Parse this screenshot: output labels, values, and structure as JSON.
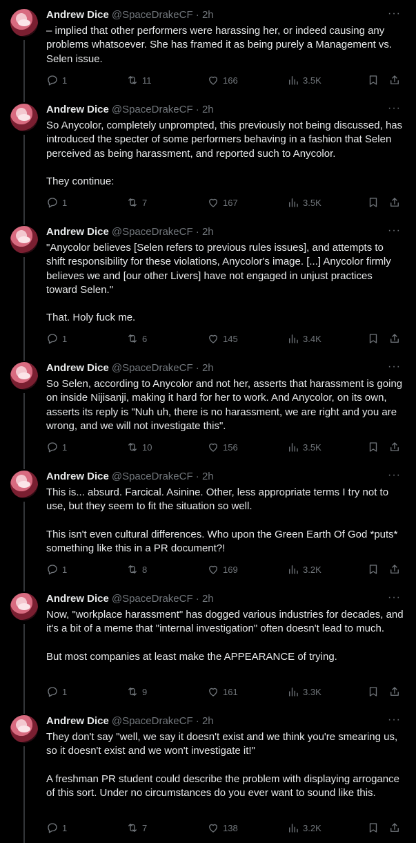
{
  "tweets": [
    {
      "name": "Andrew Dice",
      "handle": "@SpaceDrakeCF · 2h",
      "paragraphs": [
        "– implied that other performers were harassing her, or indeed causing any problems whatsoever. She has framed it as being purely a Management vs. Selen issue."
      ],
      "replies": "1",
      "retweets": "11",
      "likes": "166",
      "views": "3.5K"
    },
    {
      "name": "Andrew Dice",
      "handle": "@SpaceDrakeCF · 2h",
      "paragraphs": [
        "So Anycolor, completely unprompted, this previously not being discussed, has introduced the specter of some performers behaving in a fashion that Selen perceived as being harassment, and reported such to Anycolor.",
        "They continue:"
      ],
      "replies": "1",
      "retweets": "7",
      "likes": "167",
      "views": "3.5K"
    },
    {
      "name": "Andrew Dice",
      "handle": "@SpaceDrakeCF · 2h",
      "paragraphs": [
        "\"Anycolor believes [Selen refers to previous rules issues], and attempts to shift responsibility for these violations, Anycolor's image. [...] Anycolor firmly believes we and [our other Livers] have not engaged in unjust practices toward Selen.\"",
        "That. Holy fuck me."
      ],
      "replies": "1",
      "retweets": "6",
      "likes": "145",
      "views": "3.4K"
    },
    {
      "name": "Andrew Dice",
      "handle": "@SpaceDrakeCF · 2h",
      "paragraphs": [
        "So Selen, according to Anycolor and not her, asserts that harassment is going on inside Nijisanji, making it hard for her to work. And Anycolor, on its own, asserts its reply is \"Nuh uh, there is no harassment, we are right and you are wrong, and we will not investigate this\"."
      ],
      "replies": "1",
      "retweets": "10",
      "likes": "156",
      "views": "3.5K"
    },
    {
      "name": "Andrew Dice",
      "handle": "@SpaceDrakeCF · 2h",
      "paragraphs": [
        "This is... absurd. Farcical. Asinine. Other, less appropriate terms I try not to use, but they seem to fit the situation so well.",
        "This isn't even cultural differences. Who upon the Green Earth Of God *puts* something like this in a PR document?!"
      ],
      "replies": "1",
      "retweets": "8",
      "likes": "169",
      "views": "3.2K"
    },
    {
      "name": "Andrew Dice",
      "handle": "@SpaceDrakeCF · 2h",
      "paragraphs": [
        "Now, \"workplace harassment\" has dogged various industries for decades, and it's a bit of a meme that \"internal investigation\" often doesn't lead to much.",
        "But most companies at least make the APPEARANCE of trying."
      ],
      "replies": "1",
      "retweets": "9",
      "likes": "161",
      "views": "3.3K"
    },
    {
      "name": "Andrew Dice",
      "handle": "@SpaceDrakeCF · 2h",
      "paragraphs": [
        "They don't say \"well, we say it doesn't exist and we think you're smearing us, so it doesn't exist and we won't investigate it!\"",
        "A freshman PR student could describe the problem with displaying arrogance of this sort. Under no circumstances do you ever want to sound like this."
      ],
      "replies": "1",
      "retweets": "7",
      "likes": "138",
      "views": "3.2K"
    }
  ],
  "icons": {
    "avatar": "avatar-image",
    "more": "more-icon",
    "reply": "reply-icon",
    "retweet": "retweet-icon",
    "like": "like-icon",
    "views": "views-icon",
    "bookmark": "bookmark-icon",
    "share": "share-icon"
  },
  "colors": {
    "background": "#000000",
    "text": "#e7e9ea",
    "muted": "#71767b",
    "line": "#333639"
  }
}
